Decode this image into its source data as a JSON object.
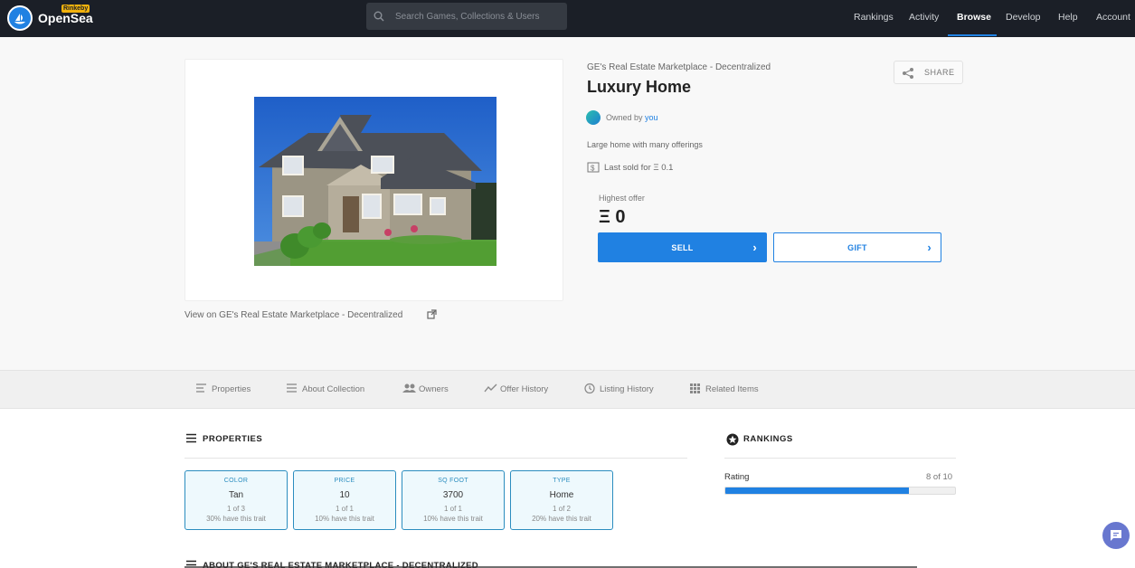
{
  "nav": {
    "brand": "OpenSea",
    "badge": "Rinkeby",
    "search_placeholder": "Search Games, Collections & Users",
    "links": [
      "Rankings",
      "Activity",
      "Browse",
      "Develop",
      "Help",
      "Account"
    ],
    "active": "Browse"
  },
  "asset": {
    "collection": "GE's Real Estate Marketplace - Decentralized",
    "title": "Luxury Home",
    "share_label": "SHARE",
    "owned_prefix": "Owned by",
    "owner": "you",
    "description": "Large home with many offerings",
    "last_sold": "Last sold for Ξ 0.1",
    "highest_offer_label": "Highest offer",
    "highest_offer": "Ξ 0",
    "sell_label": "SELL",
    "gift_label": "GIFT",
    "view_on": "View on GE's Real Estate Marketplace - Decentralized"
  },
  "tabs": [
    "Properties",
    "About Collection",
    "Owners",
    "Offer History",
    "Listing History",
    "Related Items"
  ],
  "properties": {
    "heading": "PROPERTIES",
    "traits": [
      {
        "type": "COLOR",
        "value": "Tan",
        "count": "1 of 3",
        "pct": "30% have this trait"
      },
      {
        "type": "PRICE",
        "value": "10",
        "count": "1 of 1",
        "pct": "10% have this trait"
      },
      {
        "type": "SQ FOOT",
        "value": "3700",
        "count": "1 of 1",
        "pct": "10% have this trait"
      },
      {
        "type": "TYPE",
        "value": "Home",
        "count": "1 of 2",
        "pct": "20% have this trait"
      }
    ]
  },
  "rankings": {
    "heading": "RANKINGS",
    "label": "Rating",
    "value_text": "8 of 10",
    "fraction": 0.8
  },
  "about_heading": "ABOUT GE'S REAL ESTATE MARKETPLACE - DECENTRALIZED",
  "colors": {
    "accent": "#2081e2",
    "nav_bg": "#1b1f27",
    "trait_border": "#2b8dbf"
  }
}
